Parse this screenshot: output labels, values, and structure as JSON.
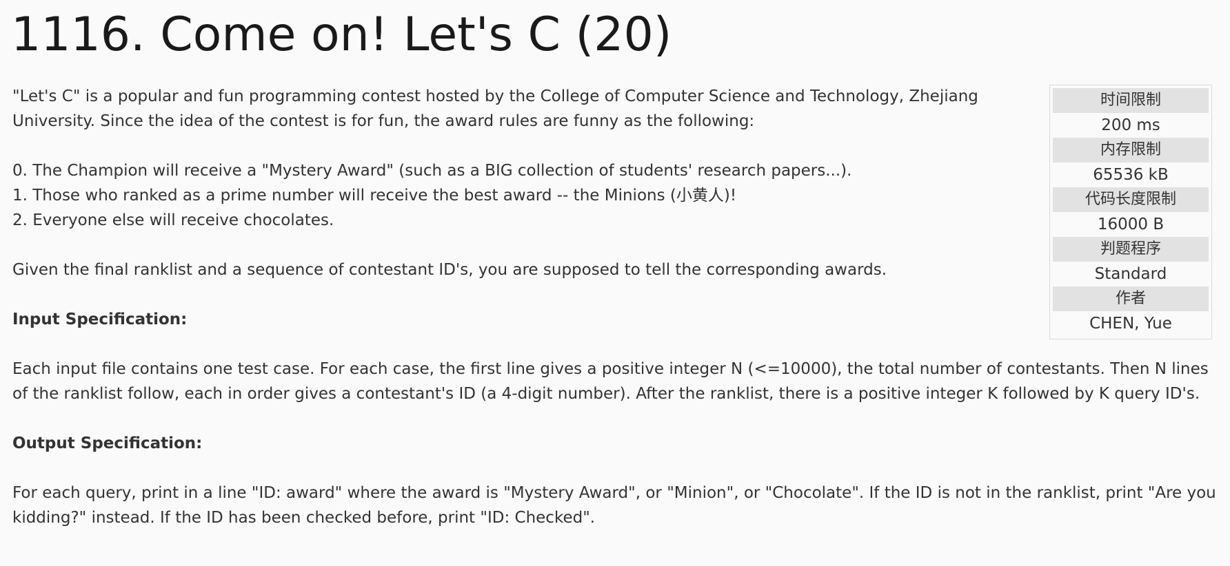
{
  "title": "1116. Come on! Let's C (20)",
  "limits": [
    {
      "label": "时间限制",
      "value": "200 ms"
    },
    {
      "label": "内存限制",
      "value": "65536 kB"
    },
    {
      "label": "代码长度限制",
      "value": "16000 B"
    },
    {
      "label": "判题程序",
      "value": "Standard"
    },
    {
      "label": "作者",
      "value": "CHEN, Yue"
    }
  ],
  "description": {
    "intro": "\"Let's C\" is a popular and fun programming contest hosted by the College of Computer Science and Technology, Zhejiang University. Since the idea of the contest is for fun, the award rules are funny as the following:",
    "rules": [
      "0. The Champion will receive a \"Mystery Award\" (such as a BIG collection of students' research papers...).",
      "1. Those who ranked as a prime number will receive the best award -- the Minions (小黄人)!",
      "2. Everyone else will receive chocolates."
    ],
    "task": "Given the final ranklist and a sequence of contestant ID's, you are supposed to tell the corresponding awards."
  },
  "input_spec": {
    "heading": "Input Specification:",
    "text": "Each input file contains one test case. For each case, the first line gives a positive integer N (<=10000), the total number of contestants. Then N lines of the ranklist follow, each in order gives a contestant's ID (a 4-digit number). After the ranklist, there is a positive integer K followed by K query ID's."
  },
  "output_spec": {
    "heading": "Output Specification:",
    "text": "For each query, print in a line \"ID: award\" where the award is \"Mystery Award\", or \"Minion\", or \"Chocolate\". If the ID is not in the ranklist, print \"Are you kidding?\" instead. If the ID has been checked before, print \"ID: Checked\"."
  }
}
